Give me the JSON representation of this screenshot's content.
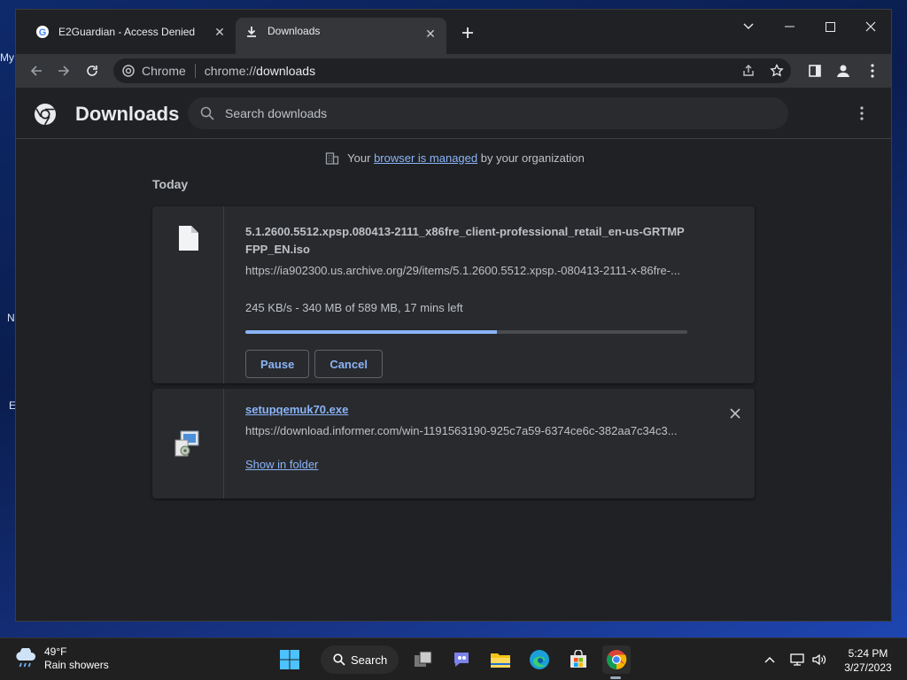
{
  "tabs": [
    {
      "title": "E2Guardian - Access Denied",
      "favicon": "google-icon",
      "active": false
    },
    {
      "title": "Downloads",
      "favicon": "download-icon",
      "active": true
    }
  ],
  "omnibox": {
    "chip": "Chrome",
    "url_scheme": "chrome://",
    "url_host": "downloads"
  },
  "page": {
    "title": "Downloads",
    "search_placeholder": "Search downloads",
    "managed": {
      "prefix": "Your",
      "link": "browser is managed",
      "suffix": "by your organization"
    },
    "section": "Today"
  },
  "downloads": [
    {
      "name": "5.1.2600.5512.xpsp.080413-2111_x86fre_client-professional_retail_en-us-GRTMPFPP_EN.iso",
      "url": "https://ia902300.us.archive.org/29/items/5.1.2600.5512.xpsp.-080413-2111-x-86fre-...",
      "status": "245 KB/s - 340 MB of 589 MB, 17 mins left",
      "progress_fraction": 0.57,
      "pause_label": "Pause",
      "cancel_label": "Cancel"
    },
    {
      "name": "setupqemuk70.exe",
      "url": "https://download.informer.com/win-1191563190-925c7a59-6374ce6c-382aa7c34c3...",
      "show_label": "Show in folder"
    }
  ],
  "taskbar": {
    "weather_temp": "49°F",
    "weather_desc": "Rain showers",
    "search_label": "Search",
    "time": "5:24 PM",
    "date": "3/27/2023"
  },
  "desktop_fragments": [
    "My",
    "N",
    "E"
  ],
  "colors": {
    "accent": "#8ab4f8",
    "page_bg": "#202124",
    "card_bg": "#292a2d"
  }
}
